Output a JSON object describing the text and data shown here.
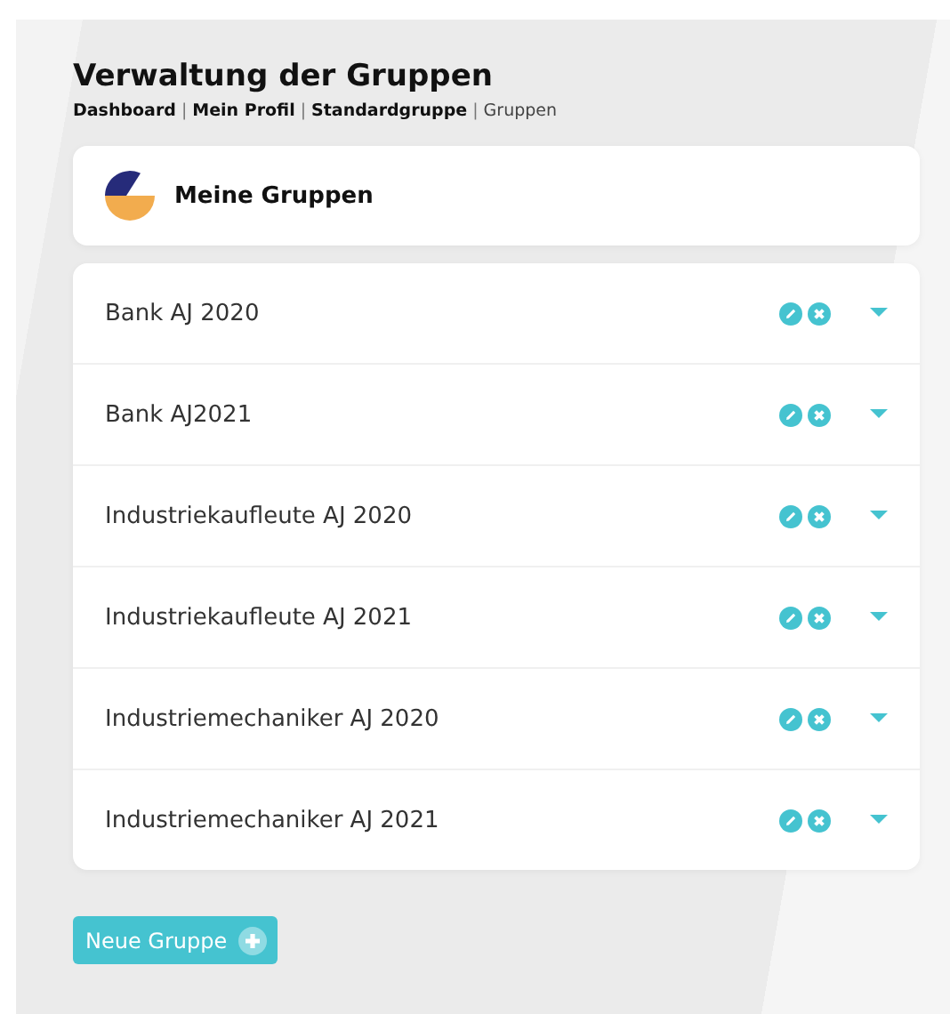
{
  "page": {
    "title": "Verwaltung der Gruppen"
  },
  "breadcrumb": [
    {
      "label": "Dashboard",
      "selected": false
    },
    {
      "separator": "|",
      "label": "Mein Profil",
      "selected": false
    },
    {
      "separator": "|",
      "label": "Standardgruppe",
      "selected": false
    },
    {
      "separator": "|",
      "label": "Gruppen",
      "selected": true
    }
  ],
  "header_card": {
    "title": "Meine Gruppen"
  },
  "groups": [
    {
      "name": "Bank AJ 2020"
    },
    {
      "name": "Bank AJ2021"
    },
    {
      "name": "Industriekaufleute AJ 2020"
    },
    {
      "name": "Industriekaufleute AJ 2021"
    },
    {
      "name": "Industriemechaniker AJ 2020"
    },
    {
      "name": "Industriemechaniker AJ 2021"
    }
  ],
  "new_group_button": {
    "label": "Neue Gruppe"
  }
}
